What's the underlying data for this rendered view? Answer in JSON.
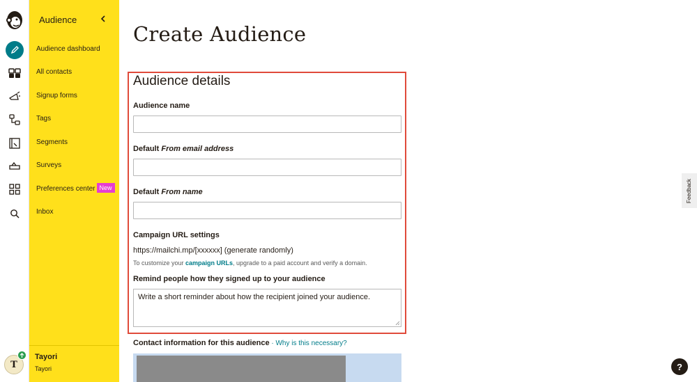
{
  "page": {
    "title": "Create Audience"
  },
  "sidebar": {
    "heading": "Audience",
    "items": [
      {
        "label": "Audience dashboard"
      },
      {
        "label": "All contacts"
      },
      {
        "label": "Signup forms"
      },
      {
        "label": "Tags"
      },
      {
        "label": "Segments"
      },
      {
        "label": "Surveys"
      },
      {
        "label": "Preferences center",
        "badge": "New"
      },
      {
        "label": "Inbox"
      }
    ],
    "user": {
      "name": "Tayori",
      "org": "Tayori",
      "initial": "T"
    }
  },
  "form": {
    "section_title": "Audience details",
    "audience_name_label": "Audience name",
    "audience_name_value": "",
    "from_email_label_prefix": "Default ",
    "from_email_label_italic": "From email address",
    "from_email_value": "",
    "from_name_label_prefix": "Default ",
    "from_name_label_italic": "From name",
    "from_name_value": "",
    "campaign_url_label": "Campaign URL settings",
    "campaign_url_value": "https://mailchi.mp/[xxxxxx] (generate randomly)",
    "campaign_hint_before": "To customize your ",
    "campaign_hint_link": "campaign URLs",
    "campaign_hint_after": ", upgrade to a paid account and verify a domain.",
    "reminder_label": "Remind people how they signed up to your audience",
    "reminder_value": "Write a short reminder about how the recipient joined your audience.",
    "contact_label": "Contact information for this audience",
    "contact_separator": " · ",
    "contact_link": "Why is this necessary?"
  },
  "utility": {
    "feedback": "Feedback",
    "help": "?"
  },
  "colors": {
    "sidebar_bg": "#ffe01b",
    "accent": "#007c89",
    "highlight_border": "#e04a3a",
    "badge": "#e63ed2"
  },
  "icons": [
    "mailchimp-logo-icon",
    "pencil-icon",
    "audience-icon",
    "megaphone-icon",
    "automation-icon",
    "website-icon",
    "content-icon",
    "integrations-grid-icon",
    "search-icon",
    "chevron-left-icon",
    "resize-handle-icon",
    "online-status-icon"
  ]
}
